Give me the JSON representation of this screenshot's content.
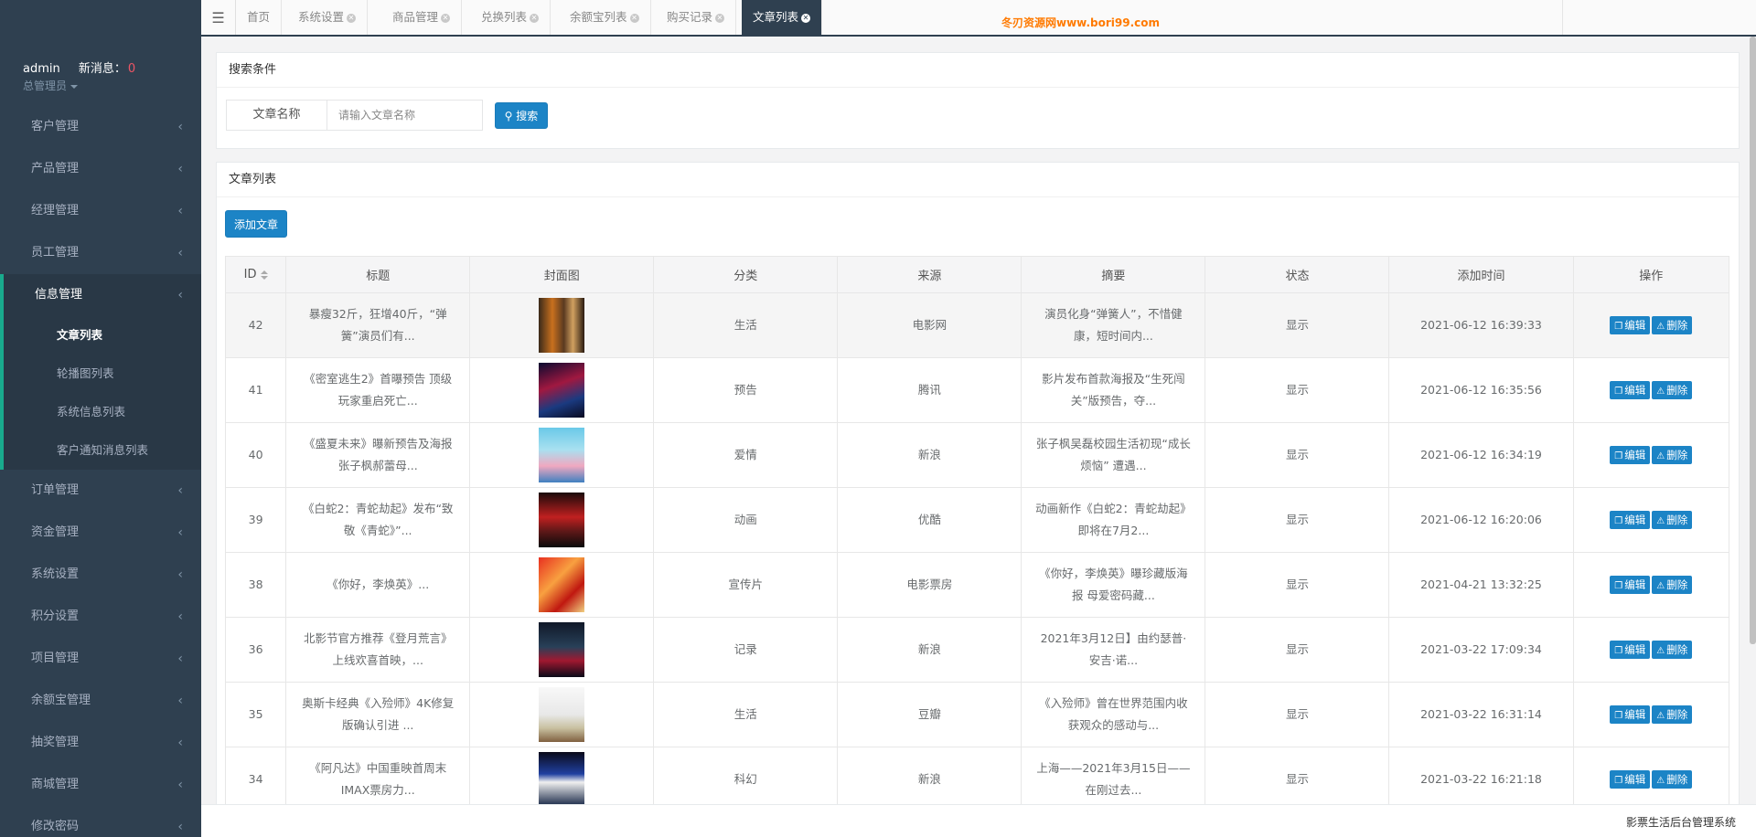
{
  "user": {
    "name": "admin",
    "msg_label": "新消息：",
    "msg_count": "0",
    "role": "总管理员"
  },
  "sidebar": {
    "items_before": [
      {
        "label": "客户管理"
      },
      {
        "label": "产品管理"
      },
      {
        "label": "经理管理"
      },
      {
        "label": "员工管理"
      }
    ],
    "active_group": {
      "label": "信息管理",
      "children": [
        {
          "label": "文章列表",
          "active": true
        },
        {
          "label": "轮播图列表"
        },
        {
          "label": "系统信息列表"
        },
        {
          "label": "客户通知消息列表"
        }
      ]
    },
    "items_after": [
      {
        "label": "订单管理"
      },
      {
        "label": "资金管理"
      },
      {
        "label": "系统设置"
      },
      {
        "label": "积分设置"
      },
      {
        "label": "项目管理"
      },
      {
        "label": "余额宝管理"
      },
      {
        "label": "抽奖管理"
      },
      {
        "label": "商城管理"
      },
      {
        "label": "修改密码"
      }
    ]
  },
  "tabs": [
    {
      "label": "首页",
      "closable": false
    },
    {
      "label": "系统设置",
      "closable": true
    },
    {
      "label": "商品管理",
      "closable": true
    },
    {
      "label": "兑换列表",
      "closable": true
    },
    {
      "label": "余额宝列表",
      "closable": true
    },
    {
      "label": "购买记录",
      "closable": true
    },
    {
      "label": "文章列表",
      "closable": true,
      "active": true
    }
  ],
  "watermark": "冬刃资源网www.bori99.com",
  "search": {
    "title": "搜索条件",
    "field_label": "文章名称",
    "placeholder": "请输入文章名称",
    "button": "搜索"
  },
  "list": {
    "title": "文章列表",
    "add_button": "添加文章",
    "columns": [
      "ID",
      "标题",
      "封面图",
      "分类",
      "来源",
      "摘要",
      "状态",
      "添加时间",
      "操作"
    ],
    "edit_label": "编辑",
    "delete_label": "删除",
    "rows": [
      {
        "id": "42",
        "title": "暴瘦32斤，狂增40斤，“弹簧”演员们有...",
        "category": "生活",
        "source": "电影网",
        "summary": "演员化身“弹簧人”，不惜健康，短时间内...",
        "status": "显示",
        "time": "2021-06-12 16:39:33"
      },
      {
        "id": "41",
        "title": "《密室逃生2》首曝预告 顶级玩家重启死亡...",
        "category": "预告",
        "source": "腾讯",
        "summary": "影片发布首款海报及“生死闯关”版预告，夺...",
        "status": "显示",
        "time": "2021-06-12 16:35:56"
      },
      {
        "id": "40",
        "title": "《盛夏未来》曝新预告及海报 张子枫郝蕾母...",
        "category": "爱情",
        "source": "新浪",
        "summary": "张子枫吴磊校园生活初现“成长烦恼” 遭遇...",
        "status": "显示",
        "time": "2021-06-12 16:34:19"
      },
      {
        "id": "39",
        "title": "《白蛇2：青蛇劫起》发布“致敬《青蛇》”...",
        "category": "动画",
        "source": "优酷",
        "summary": "动画新作《白蛇2：青蛇劫起》即将在7月2...",
        "status": "显示",
        "time": "2021-06-12 16:20:06"
      },
      {
        "id": "38",
        "title": "《你好，李焕英》...",
        "category": "宣传片",
        "source": "电影票房",
        "summary": "《你好，李焕英》曝珍藏版海报 母爱密码藏...",
        "status": "显示",
        "time": "2021-04-21 13:32:25"
      },
      {
        "id": "36",
        "title": "北影节官方推荐《登月荒言》上线欢喜首映，...",
        "category": "记录",
        "source": "新浪",
        "summary": "2021年3月12日】由约瑟普·安吉·诺...",
        "status": "显示",
        "time": "2021-03-22 17:09:34"
      },
      {
        "id": "35",
        "title": "奥斯卡经典《入殓师》4K修复版确认引进 ...",
        "category": "生活",
        "source": "豆瓣",
        "summary": "《入殓师》曾在世界范围内收获观众的感动与...",
        "status": "显示",
        "time": "2021-03-22 16:31:14"
      },
      {
        "id": "34",
        "title": "《阿凡达》中国重映首周末IMAX票房力...",
        "category": "科幻",
        "source": "新浪",
        "summary": "上海——2021年3月15日——在刚过去...",
        "status": "显示",
        "time": "2021-03-22 16:21:18"
      }
    ]
  },
  "footer": "影票生活后台管理系统"
}
